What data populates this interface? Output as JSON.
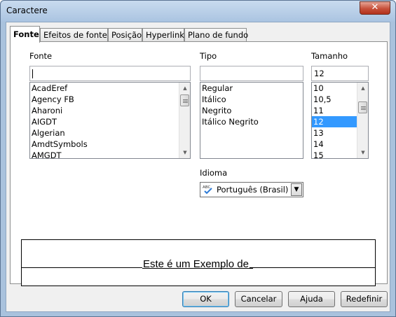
{
  "window": {
    "title": "Caractere",
    "close_glyph": "✕"
  },
  "tabs": [
    {
      "label": "Fonte",
      "active": true
    },
    {
      "label": "Efeitos de fonte",
      "active": false
    },
    {
      "label": "Posição",
      "active": false
    },
    {
      "label": "Hyperlink",
      "active": false
    },
    {
      "label": "Plano de fundo",
      "active": false
    }
  ],
  "font": {
    "label": "Fonte",
    "value": "",
    "items": [
      "AcadEref",
      "Agency FB",
      "Aharoni",
      "AIGDT",
      "Algerian",
      "AmdtSymbols",
      "AMGDT"
    ]
  },
  "style": {
    "label": "Tipo",
    "value": "",
    "items": [
      "Regular",
      "Itálico",
      "Negrito",
      "Itálico Negrito"
    ]
  },
  "size": {
    "label": "Tamanho",
    "value": "12",
    "items": [
      "10",
      "10,5",
      "11",
      "12",
      "13",
      "14",
      "15"
    ],
    "selected": "12"
  },
  "language": {
    "label": "Idioma",
    "value": "Português (Brasil)",
    "icon": "abc-spellcheck-icon"
  },
  "preview": {
    "text": "Este é um Exemplo de"
  },
  "buttons": {
    "ok": "OK",
    "cancel": "Cancelar",
    "help": "Ajuda",
    "reset": "Redefinir"
  },
  "colors": {
    "selection": "#3399ff",
    "titlebar": "#aac4e1",
    "close": "#c7503b"
  }
}
